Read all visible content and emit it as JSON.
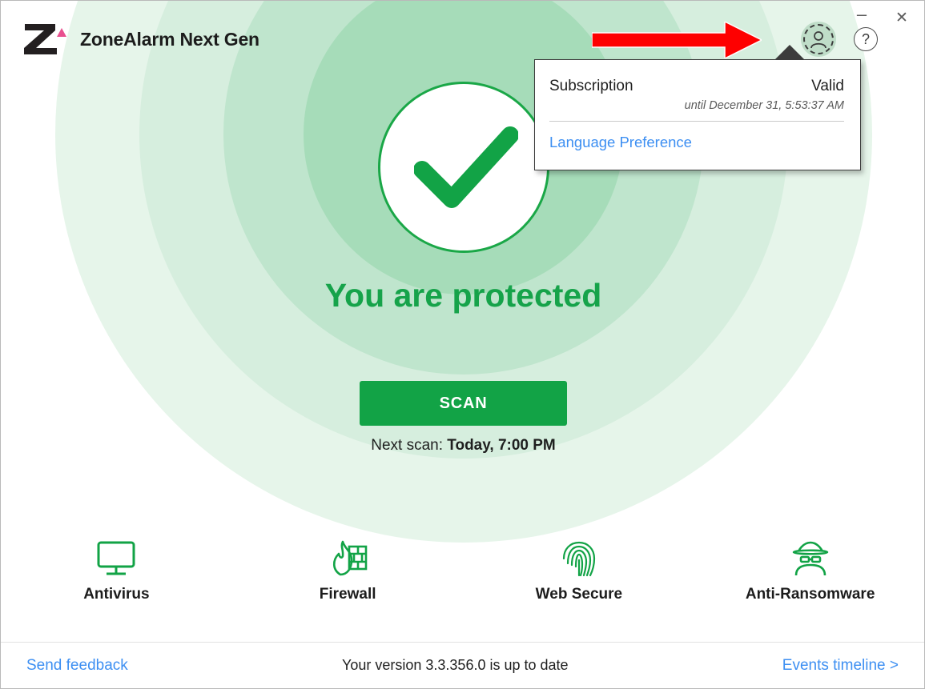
{
  "window": {
    "title": "ZoneAlarm Next Gen",
    "minimize_label": "–",
    "close_label": "✕"
  },
  "header": {
    "logo_name": "zonealarm-logo",
    "account_icon": "account-avatar-icon",
    "help_icon": "help-question-icon",
    "annotation_arrow": "red-pointer-arrow"
  },
  "popup": {
    "label": "Subscription",
    "value": "Valid",
    "until": "until December 31, 5:53:37 AM",
    "link": "Language Preference"
  },
  "main": {
    "status_icon": "green-checkmark-icon",
    "status_text": "You are protected",
    "scan_button": "SCAN",
    "next_scan_prefix": "Next scan: ",
    "next_scan_value": "Today, 7:00 PM"
  },
  "features": [
    {
      "label": "Antivirus",
      "icon": "monitor-icon"
    },
    {
      "label": "Firewall",
      "icon": "firewall-flame-icon"
    },
    {
      "label": "Web Secure",
      "icon": "fingerprint-icon"
    },
    {
      "label": "Anti-Ransomware",
      "icon": "spy-hacker-icon"
    }
  ],
  "footer": {
    "feedback": "Send feedback",
    "version": "Your version 3.3.356.0 is up to date",
    "events": "Events timeline >"
  },
  "colors": {
    "brand_green": "#12a346",
    "status_green": "#16a34a",
    "link_blue": "#3d8ff2",
    "logo_dark": "#231f20",
    "logo_pink": "#e8508f",
    "annotation_red": "#fe0000"
  }
}
